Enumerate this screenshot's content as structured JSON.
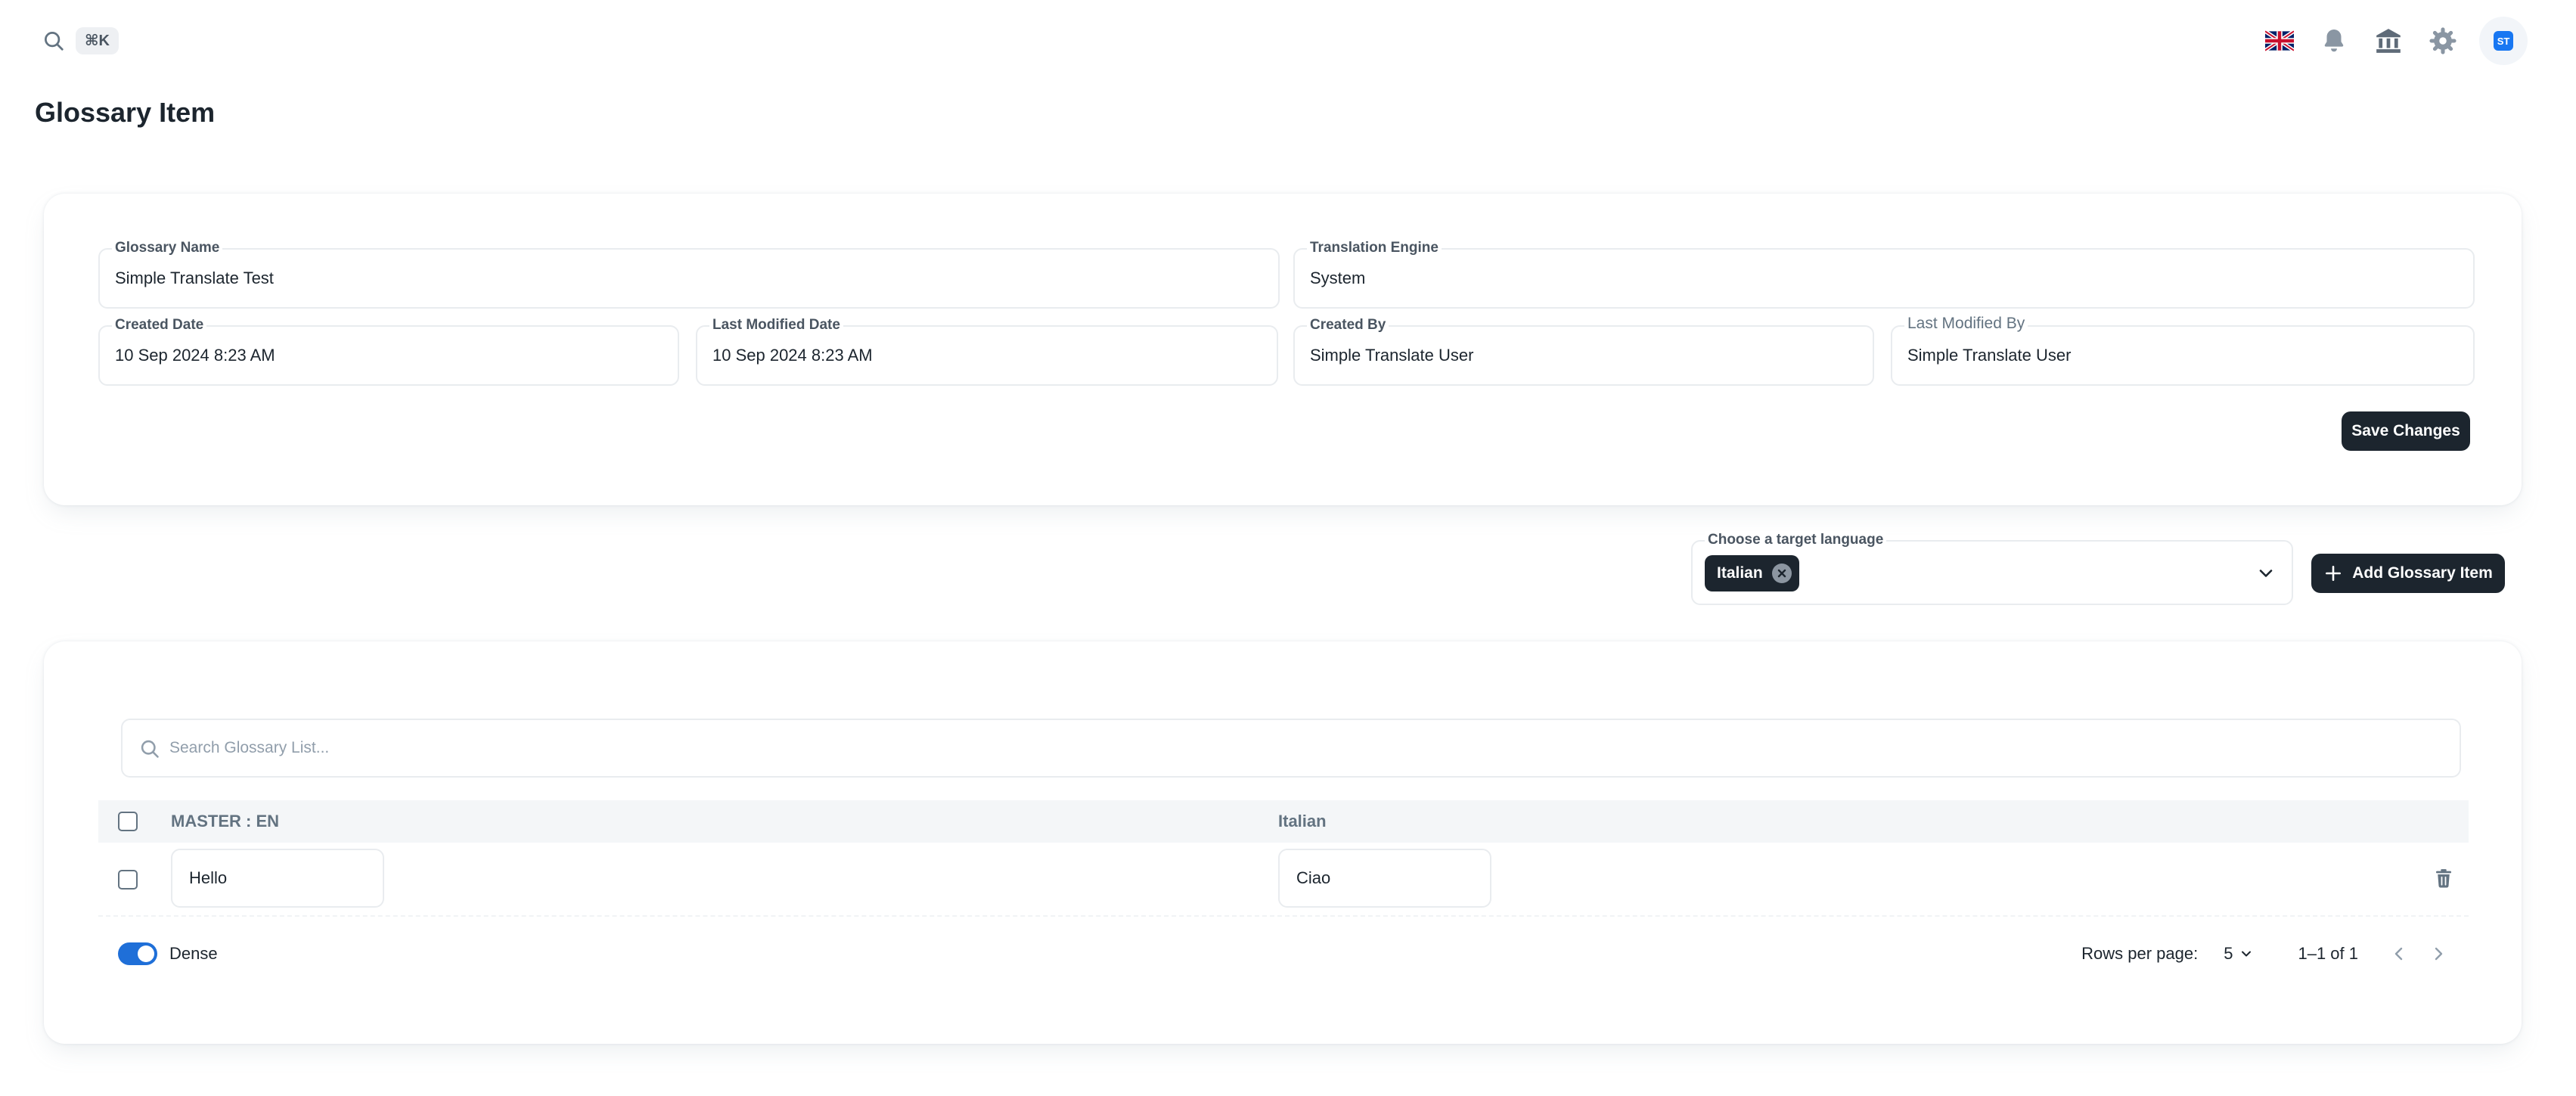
{
  "header": {
    "search_shortcut": "⌘K",
    "icons": [
      "uk-flag-icon",
      "bell-icon",
      "organization-icon",
      "settings-gear-icon"
    ],
    "avatar_initials": "ST"
  },
  "page": {
    "title": "Glossary Item"
  },
  "details": {
    "glossary_name": {
      "label": "Glossary Name",
      "value": "Simple Translate Test"
    },
    "translation_engine": {
      "label": "Translation Engine",
      "value": "System"
    },
    "created_date": {
      "label": "Created Date",
      "value": "10 Sep 2024 8:23 AM"
    },
    "last_modified_date": {
      "label": "Last Modified Date",
      "value": "10 Sep 2024 8:23 AM"
    },
    "created_by": {
      "label": "Created By",
      "value": "Simple Translate User"
    },
    "last_modified_by": {
      "label": "Last Modified By",
      "value": "Simple Translate User"
    },
    "save_label": "Save Changes"
  },
  "target_language": {
    "label": "Choose a target language",
    "selected": [
      "Italian"
    ],
    "add_label": "Add Glossary Item"
  },
  "table": {
    "search_placeholder": "Search Glossary List...",
    "columns": [
      "MASTER : EN",
      "Italian"
    ],
    "rows": [
      {
        "master": "Hello",
        "translation": "Ciao"
      }
    ],
    "dense_label": "Dense",
    "dense_on": true,
    "rows_per_page_label": "Rows per page:",
    "rows_per_page": "5",
    "range_label": "1–1 of 1"
  },
  "colors": {
    "primary_dark": "#1c252e",
    "switch_blue": "#1f6fd8",
    "border": "#e9ecef",
    "muted_text": "#637381"
  }
}
